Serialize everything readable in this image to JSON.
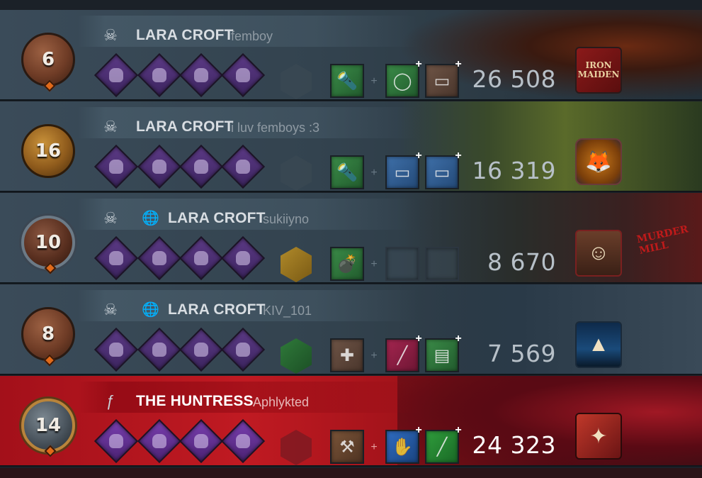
{
  "rows": [
    {
      "level": "6",
      "character": "LARA CROFT",
      "player": "femboy",
      "crossplay": false,
      "perks": [
        "perk",
        "perk",
        "perk",
        "perk"
      ],
      "offering": "empty",
      "item": "flashlight",
      "addons": [
        "bulb",
        "battery"
      ],
      "score": "26 508",
      "portrait": "IRON MAIDEN",
      "portrait_icon": "iron-maiden-charm"
    },
    {
      "level": "16",
      "character": "LARA CROFT",
      "player": "i luv femboys :3",
      "crossplay": false,
      "perks": [
        "perk",
        "perk",
        "perk",
        "perk"
      ],
      "offering": "empty",
      "item": "flashlight",
      "addons": [
        "battery",
        "battery"
      ],
      "score": "16 319",
      "portrait": "fox",
      "portrait_icon": "fox-charm"
    },
    {
      "level": "10",
      "character": "LARA CROFT",
      "player": "sukiiyno",
      "crossplay": true,
      "perks": [
        "perk",
        "perk",
        "perk",
        "perk"
      ],
      "offering": "bread",
      "item": "grenade",
      "addons": [
        "empty",
        "empty"
      ],
      "score": "8 670",
      "portrait": "lara",
      "portrait_icon": "lara-portrait",
      "map_label": "MURDER MILL"
    },
    {
      "level": "8",
      "character": "LARA CROFT",
      "player": "KIV_101",
      "crossplay": true,
      "perks": [
        "perk",
        "perk",
        "perk",
        "perk"
      ],
      "offering": "cake",
      "item": "medkit",
      "addons": [
        "syringe",
        "bandage"
      ],
      "score": "7 569",
      "portrait": "lighthouse",
      "portrait_icon": "lighthouse-charm"
    },
    {
      "level": "14",
      "character": "THE HUNTRESS",
      "player": "Aphlykted",
      "crossplay": false,
      "perks": [
        "perk",
        "perk",
        "perk",
        "perk"
      ],
      "offering": "empty",
      "item": "hatchet",
      "addons": [
        "gloves",
        "stick"
      ],
      "score": "24 323",
      "portrait": "huntress",
      "portrait_icon": "huntress-portrait"
    }
  ],
  "colors": {
    "survivor_row": "#33434f",
    "killer_row": "#c01a22",
    "perk_purple": "#5c3a86"
  }
}
